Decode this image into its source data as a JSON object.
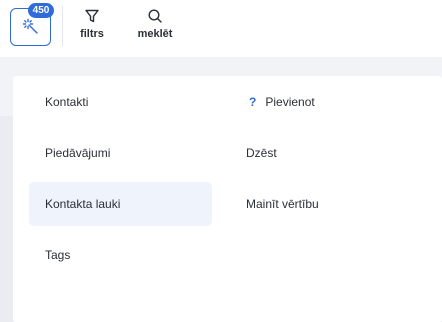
{
  "toolbar": {
    "badge_count": "450",
    "filter_label": "filtrs",
    "search_label": "meklēt",
    "accent": "#2f6bd9"
  },
  "menu": {
    "left_items": [
      {
        "label": "Kontakti"
      },
      {
        "label": "Piedāvājumi"
      },
      {
        "label": "Kontakta lauki",
        "active": true
      },
      {
        "label": "Tags"
      }
    ],
    "right_items": [
      {
        "label": "Pievienot",
        "icon": "question-icon"
      },
      {
        "label": "Dzēst"
      },
      {
        "label": "Mainīt vērtību"
      }
    ]
  }
}
